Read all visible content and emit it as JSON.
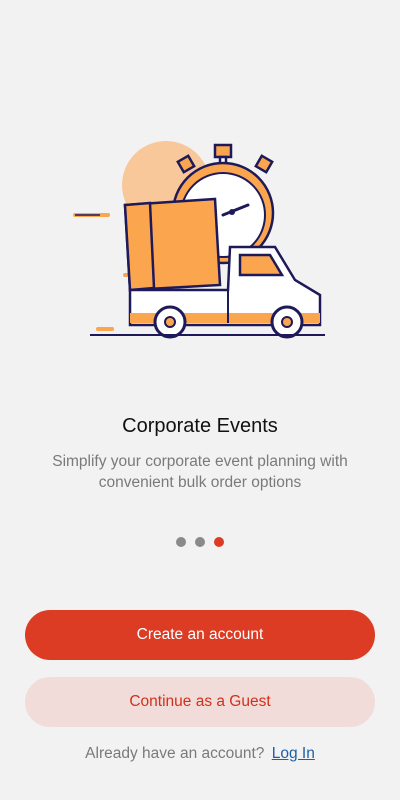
{
  "illustration": {
    "icon": "delivery-truck-stopwatch-illustration",
    "colors": {
      "orange": "#fca54f",
      "light_orange": "#f8c89a",
      "navy": "#1e1a5a",
      "white": "#ffffff"
    }
  },
  "onboarding": {
    "title": "Corporate Events",
    "description": "Simplify your corporate event planning with convenient bulk order options",
    "pages": 3,
    "active_page": 3
  },
  "actions": {
    "create_account_label": "Create an account",
    "guest_label": "Continue as a Guest",
    "login_prompt": "Already have an account?",
    "login_link": "Log In"
  },
  "colors": {
    "primary": "#dc3b24",
    "secondary_bg": "#f2dcd9",
    "link": "#1d5fa8",
    "background": "#f2f2f2"
  }
}
